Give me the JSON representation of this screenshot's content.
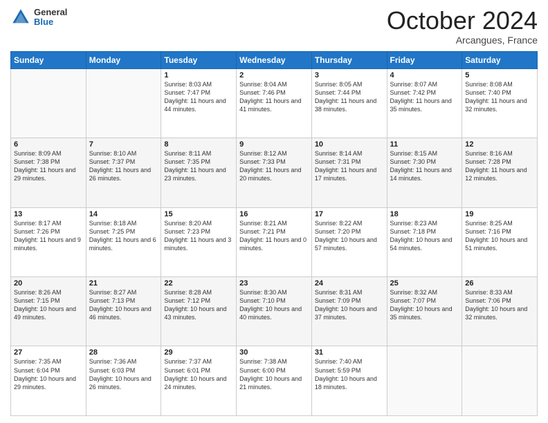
{
  "header": {
    "logo": {
      "general": "General",
      "blue": "Blue"
    },
    "title": "October 2024",
    "location": "Arcangues, France"
  },
  "days_of_week": [
    "Sunday",
    "Monday",
    "Tuesday",
    "Wednesday",
    "Thursday",
    "Friday",
    "Saturday"
  ],
  "weeks": [
    [
      {
        "day": "",
        "sunrise": "",
        "sunset": "",
        "daylight": ""
      },
      {
        "day": "",
        "sunrise": "",
        "sunset": "",
        "daylight": ""
      },
      {
        "day": "1",
        "sunrise": "Sunrise: 8:03 AM",
        "sunset": "Sunset: 7:47 PM",
        "daylight": "Daylight: 11 hours and 44 minutes."
      },
      {
        "day": "2",
        "sunrise": "Sunrise: 8:04 AM",
        "sunset": "Sunset: 7:46 PM",
        "daylight": "Daylight: 11 hours and 41 minutes."
      },
      {
        "day": "3",
        "sunrise": "Sunrise: 8:05 AM",
        "sunset": "Sunset: 7:44 PM",
        "daylight": "Daylight: 11 hours and 38 minutes."
      },
      {
        "day": "4",
        "sunrise": "Sunrise: 8:07 AM",
        "sunset": "Sunset: 7:42 PM",
        "daylight": "Daylight: 11 hours and 35 minutes."
      },
      {
        "day": "5",
        "sunrise": "Sunrise: 8:08 AM",
        "sunset": "Sunset: 7:40 PM",
        "daylight": "Daylight: 11 hours and 32 minutes."
      }
    ],
    [
      {
        "day": "6",
        "sunrise": "Sunrise: 8:09 AM",
        "sunset": "Sunset: 7:38 PM",
        "daylight": "Daylight: 11 hours and 29 minutes."
      },
      {
        "day": "7",
        "sunrise": "Sunrise: 8:10 AM",
        "sunset": "Sunset: 7:37 PM",
        "daylight": "Daylight: 11 hours and 26 minutes."
      },
      {
        "day": "8",
        "sunrise": "Sunrise: 8:11 AM",
        "sunset": "Sunset: 7:35 PM",
        "daylight": "Daylight: 11 hours and 23 minutes."
      },
      {
        "day": "9",
        "sunrise": "Sunrise: 8:12 AM",
        "sunset": "Sunset: 7:33 PM",
        "daylight": "Daylight: 11 hours and 20 minutes."
      },
      {
        "day": "10",
        "sunrise": "Sunrise: 8:14 AM",
        "sunset": "Sunset: 7:31 PM",
        "daylight": "Daylight: 11 hours and 17 minutes."
      },
      {
        "day": "11",
        "sunrise": "Sunrise: 8:15 AM",
        "sunset": "Sunset: 7:30 PM",
        "daylight": "Daylight: 11 hours and 14 minutes."
      },
      {
        "day": "12",
        "sunrise": "Sunrise: 8:16 AM",
        "sunset": "Sunset: 7:28 PM",
        "daylight": "Daylight: 11 hours and 12 minutes."
      }
    ],
    [
      {
        "day": "13",
        "sunrise": "Sunrise: 8:17 AM",
        "sunset": "Sunset: 7:26 PM",
        "daylight": "Daylight: 11 hours and 9 minutes."
      },
      {
        "day": "14",
        "sunrise": "Sunrise: 8:18 AM",
        "sunset": "Sunset: 7:25 PM",
        "daylight": "Daylight: 11 hours and 6 minutes."
      },
      {
        "day": "15",
        "sunrise": "Sunrise: 8:20 AM",
        "sunset": "Sunset: 7:23 PM",
        "daylight": "Daylight: 11 hours and 3 minutes."
      },
      {
        "day": "16",
        "sunrise": "Sunrise: 8:21 AM",
        "sunset": "Sunset: 7:21 PM",
        "daylight": "Daylight: 11 hours and 0 minutes."
      },
      {
        "day": "17",
        "sunrise": "Sunrise: 8:22 AM",
        "sunset": "Sunset: 7:20 PM",
        "daylight": "Daylight: 10 hours and 57 minutes."
      },
      {
        "day": "18",
        "sunrise": "Sunrise: 8:23 AM",
        "sunset": "Sunset: 7:18 PM",
        "daylight": "Daylight: 10 hours and 54 minutes."
      },
      {
        "day": "19",
        "sunrise": "Sunrise: 8:25 AM",
        "sunset": "Sunset: 7:16 PM",
        "daylight": "Daylight: 10 hours and 51 minutes."
      }
    ],
    [
      {
        "day": "20",
        "sunrise": "Sunrise: 8:26 AM",
        "sunset": "Sunset: 7:15 PM",
        "daylight": "Daylight: 10 hours and 49 minutes."
      },
      {
        "day": "21",
        "sunrise": "Sunrise: 8:27 AM",
        "sunset": "Sunset: 7:13 PM",
        "daylight": "Daylight: 10 hours and 46 minutes."
      },
      {
        "day": "22",
        "sunrise": "Sunrise: 8:28 AM",
        "sunset": "Sunset: 7:12 PM",
        "daylight": "Daylight: 10 hours and 43 minutes."
      },
      {
        "day": "23",
        "sunrise": "Sunrise: 8:30 AM",
        "sunset": "Sunset: 7:10 PM",
        "daylight": "Daylight: 10 hours and 40 minutes."
      },
      {
        "day": "24",
        "sunrise": "Sunrise: 8:31 AM",
        "sunset": "Sunset: 7:09 PM",
        "daylight": "Daylight: 10 hours and 37 minutes."
      },
      {
        "day": "25",
        "sunrise": "Sunrise: 8:32 AM",
        "sunset": "Sunset: 7:07 PM",
        "daylight": "Daylight: 10 hours and 35 minutes."
      },
      {
        "day": "26",
        "sunrise": "Sunrise: 8:33 AM",
        "sunset": "Sunset: 7:06 PM",
        "daylight": "Daylight: 10 hours and 32 minutes."
      }
    ],
    [
      {
        "day": "27",
        "sunrise": "Sunrise: 7:35 AM",
        "sunset": "Sunset: 6:04 PM",
        "daylight": "Daylight: 10 hours and 29 minutes."
      },
      {
        "day": "28",
        "sunrise": "Sunrise: 7:36 AM",
        "sunset": "Sunset: 6:03 PM",
        "daylight": "Daylight: 10 hours and 26 minutes."
      },
      {
        "day": "29",
        "sunrise": "Sunrise: 7:37 AM",
        "sunset": "Sunset: 6:01 PM",
        "daylight": "Daylight: 10 hours and 24 minutes."
      },
      {
        "day": "30",
        "sunrise": "Sunrise: 7:38 AM",
        "sunset": "Sunset: 6:00 PM",
        "daylight": "Daylight: 10 hours and 21 minutes."
      },
      {
        "day": "31",
        "sunrise": "Sunrise: 7:40 AM",
        "sunset": "Sunset: 5:59 PM",
        "daylight": "Daylight: 10 hours and 18 minutes."
      },
      {
        "day": "",
        "sunrise": "",
        "sunset": "",
        "daylight": ""
      },
      {
        "day": "",
        "sunrise": "",
        "sunset": "",
        "daylight": ""
      }
    ]
  ]
}
